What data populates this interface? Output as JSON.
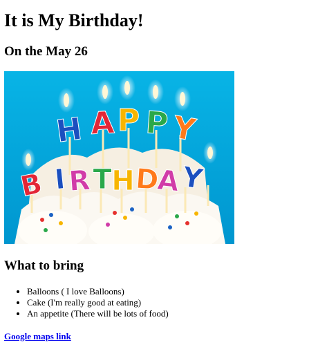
{
  "heading": "It is My Birthday!",
  "date_heading": "On the May 26",
  "image": {
    "description_icon": "birthday-candles-photo",
    "top_word": "HAPPY",
    "bottom_word": "BIRTHDAY",
    "colors": {
      "sky": "#00a8dc",
      "frosting": "#f7f1e4",
      "flame": "#fff6c8"
    }
  },
  "bring_heading": "What to bring",
  "bring_items": [
    "Balloons ( I love Balloons)",
    "Cake (I'm really good at eating)",
    "An appetite (There will be lots of food)"
  ],
  "maps_link": "Google maps link",
  "link_color": "#0000ee"
}
